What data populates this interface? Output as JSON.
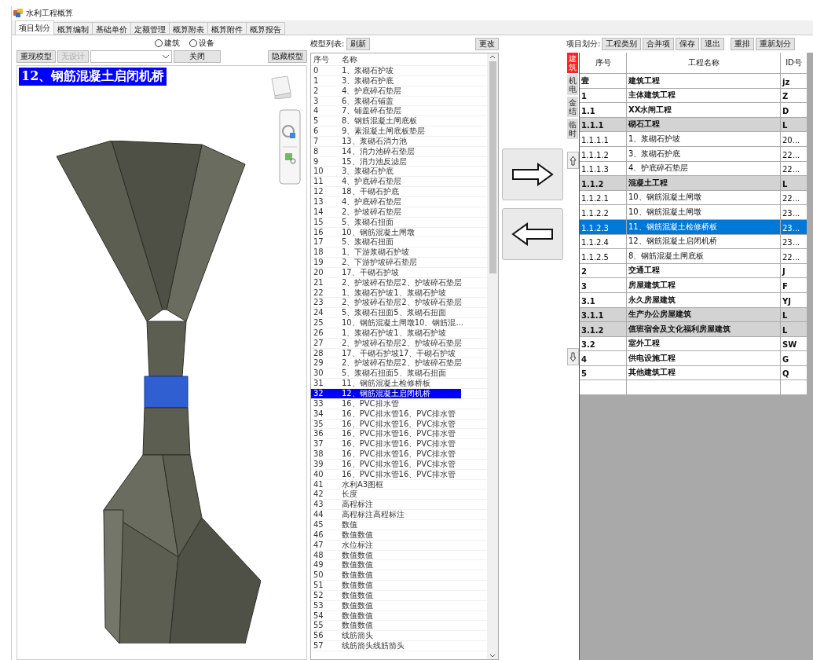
{
  "window": {
    "title": "水利工程概算"
  },
  "tabs": [
    {
      "label": "项目划分",
      "selected": true
    },
    {
      "label": "概算编制",
      "selected": false
    },
    {
      "label": "基础单价",
      "selected": false
    },
    {
      "label": "定额管理",
      "selected": false
    },
    {
      "label": "概算附表",
      "selected": false
    },
    {
      "label": "概算附件",
      "selected": false
    },
    {
      "label": "概算报告",
      "selected": false
    }
  ],
  "model_panel": {
    "radios": [
      {
        "label": "建筑",
        "checked": false
      },
      {
        "label": "设备",
        "checked": false
      }
    ],
    "buttons": [
      {
        "label": "重现模型",
        "disabled": false
      },
      {
        "label": "无设计",
        "disabled": true
      }
    ],
    "close_button": "关闭",
    "hide_button": "隐藏模型",
    "banner": "12、钢筋混凝土启闭机桥"
  },
  "model_list": {
    "label": "模型列表:",
    "refresh_button": "刷新",
    "change_button": "更改",
    "columns": [
      "序号",
      "名称"
    ],
    "rows": [
      {
        "index": "0",
        "name": "1、浆砌石护坡",
        "selected": false
      },
      {
        "index": "1",
        "name": "3、浆砌石护底",
        "selected": false
      },
      {
        "index": "2",
        "name": "4、护底碎石垫层",
        "selected": false
      },
      {
        "index": "3",
        "name": "6、浆砌石铺盖",
        "selected": false
      },
      {
        "index": "4",
        "name": "7、铺盖碎石垫层",
        "selected": false
      },
      {
        "index": "5",
        "name": "8、钢筋混凝土闸底板",
        "selected": false
      },
      {
        "index": "6",
        "name": "9、素混凝土闸底板垫层",
        "selected": false
      },
      {
        "index": "7",
        "name": "13、浆砌石消力池",
        "selected": false
      },
      {
        "index": "8",
        "name": "14、消力池碎石垫层",
        "selected": false
      },
      {
        "index": "9",
        "name": "15、消力池反滤层",
        "selected": false
      },
      {
        "index": "10",
        "name": "3、浆砌石护底",
        "selected": false
      },
      {
        "index": "11",
        "name": "4、护底碎石垫层",
        "selected": false
      },
      {
        "index": "12",
        "name": "18、干砌石护底",
        "selected": false
      },
      {
        "index": "13",
        "name": "4、护底碎石垫层",
        "selected": false
      },
      {
        "index": "14",
        "name": "2、护坡碎石垫层",
        "selected": false
      },
      {
        "index": "15",
        "name": "5、浆砌石扭面",
        "selected": false
      },
      {
        "index": "16",
        "name": "10、钢筋混凝土闸墩",
        "selected": false
      },
      {
        "index": "17",
        "name": "5、浆砌石扭面",
        "selected": false
      },
      {
        "index": "18",
        "name": "1、下游浆砌石护坡",
        "selected": false
      },
      {
        "index": "19",
        "name": "2、下游护坡碎石垫层",
        "selected": false
      },
      {
        "index": "20",
        "name": "17、干砌石护坡",
        "selected": false
      },
      {
        "index": "21",
        "name": "2、护坡碎石垫层2、护坡碎石垫层",
        "selected": false
      },
      {
        "index": "22",
        "name": "1、浆砌石护坡1、浆砌石护坡",
        "selected": false
      },
      {
        "index": "23",
        "name": "2、护坡碎石垫层2、护坡碎石垫层",
        "selected": false
      },
      {
        "index": "24",
        "name": "5、浆砌石扭面5、浆砌石扭面",
        "selected": false
      },
      {
        "index": "25",
        "name": "10、钢筋混凝土闸墩10、钢筋混...",
        "selected": false
      },
      {
        "index": "26",
        "name": "1、浆砌石护坡1、浆砌石护坡",
        "selected": false
      },
      {
        "index": "27",
        "name": "2、护坡碎石垫层2、护坡碎石垫层",
        "selected": false
      },
      {
        "index": "28",
        "name": "17、干砌石护坡17、干砌石护坡",
        "selected": false
      },
      {
        "index": "29",
        "name": "2、护坡碎石垫层2、护坡碎石垫层",
        "selected": false
      },
      {
        "index": "30",
        "name": "5、浆砌石扭面5、浆砌石扭面",
        "selected": false
      },
      {
        "index": "31",
        "name": "11、钢筋混凝土检修桥板",
        "selected": false
      },
      {
        "index": "32",
        "name": "12、钢筋混凝土启闭机桥",
        "selected": true
      },
      {
        "index": "33",
        "name": "16、PVC排水管",
        "selected": false
      },
      {
        "index": "34",
        "name": "16、PVC排水管16、PVC排水管",
        "selected": false
      },
      {
        "index": "35",
        "name": "16、PVC排水管16、PVC排水管",
        "selected": false
      },
      {
        "index": "36",
        "name": "16、PVC排水管16、PVC排水管",
        "selected": false
      },
      {
        "index": "37",
        "name": "16、PVC排水管16、PVC排水管",
        "selected": false
      },
      {
        "index": "38",
        "name": "16、PVC排水管16、PVC排水管",
        "selected": false
      },
      {
        "index": "39",
        "name": "16、PVC排水管16、PVC排水管",
        "selected": false
      },
      {
        "index": "40",
        "name": "16、PVC排水管16、PVC排水管",
        "selected": false
      },
      {
        "index": "41",
        "name": "水利A3图框",
        "selected": false
      },
      {
        "index": "42",
        "name": "长度",
        "selected": false
      },
      {
        "index": "43",
        "name": "高程标注",
        "selected": false
      },
      {
        "index": "44",
        "name": "高程标注高程标注",
        "selected": false
      },
      {
        "index": "45",
        "name": "数值",
        "selected": false
      },
      {
        "index": "46",
        "name": "数值数值",
        "selected": false
      },
      {
        "index": "47",
        "name": "水位标注",
        "selected": false
      },
      {
        "index": "48",
        "name": "数值数值",
        "selected": false
      },
      {
        "index": "49",
        "name": "数值数值",
        "selected": false
      },
      {
        "index": "50",
        "name": "数值数值",
        "selected": false
      },
      {
        "index": "51",
        "name": "数值数值",
        "selected": false
      },
      {
        "index": "52",
        "name": "数值数值",
        "selected": false
      },
      {
        "index": "53",
        "name": "数值数值",
        "selected": false
      },
      {
        "index": "54",
        "name": "数值数值",
        "selected": false
      },
      {
        "index": "55",
        "name": "数值数值",
        "selected": false
      },
      {
        "index": "56",
        "name": "线筋箭头",
        "selected": false
      },
      {
        "index": "57",
        "name": "线筋箭头线筋箭头",
        "selected": false
      }
    ]
  },
  "project_division": {
    "label": "项目划分:",
    "buttons": [
      "工程类别",
      "合并项",
      "保存",
      "退出",
      "重排",
      "重新划分"
    ],
    "side_tabs": [
      {
        "label": "建筑",
        "selected": true
      },
      {
        "label": "机电",
        "selected": false
      },
      {
        "label": "金结",
        "selected": false
      },
      {
        "label": "临时",
        "selected": false
      }
    ],
    "columns": [
      "序号",
      "工程名称",
      "ID号"
    ],
    "rows": [
      {
        "number": "壹",
        "name": "建筑工程",
        "id": "jz",
        "kind": "heading",
        "selected": false
      },
      {
        "number": "1",
        "name": "主体建筑工程",
        "id": "Z",
        "kind": "heading",
        "selected": false
      },
      {
        "number": "1.1",
        "name": "XX水闸工程",
        "id": "D",
        "kind": "heading",
        "selected": false
      },
      {
        "number": "1.1.1",
        "name": "砌石工程",
        "id": "L",
        "kind": "group",
        "selected": false
      },
      {
        "number": "1.1.1.1",
        "name": "1、浆砌石护坡",
        "id": "20...",
        "kind": "item",
        "selected": false
      },
      {
        "number": "1.1.1.2",
        "name": "3、浆砌石护底",
        "id": "22...",
        "kind": "item",
        "selected": false
      },
      {
        "number": "1.1.1.3",
        "name": "4、护底碎石垫层",
        "id": "22...",
        "kind": "item",
        "selected": false
      },
      {
        "number": "1.1.2",
        "name": "混凝土工程",
        "id": "L",
        "kind": "group",
        "selected": false
      },
      {
        "number": "1.1.2.1",
        "name": "10、钢筋混凝土闸墩",
        "id": "22...",
        "kind": "item",
        "selected": false
      },
      {
        "number": "1.1.2.2",
        "name": "10、钢筋混凝土闸墩",
        "id": "23...",
        "kind": "item",
        "selected": false
      },
      {
        "number": "1.1.2.3",
        "name": "11、钢筋混凝土检修桥板",
        "id": "23...",
        "kind": "item",
        "selected": true
      },
      {
        "number": "1.1.2.4",
        "name": "12、钢筋混凝土启闭机桥",
        "id": "23...",
        "kind": "item",
        "selected": false
      },
      {
        "number": "1.1.2.5",
        "name": "8、钢筋混凝土闸底板",
        "id": "22...",
        "kind": "item",
        "selected": false
      },
      {
        "number": "2",
        "name": "交通工程",
        "id": "J",
        "kind": "heading",
        "selected": false
      },
      {
        "number": "3",
        "name": "房屋建筑工程",
        "id": "F",
        "kind": "heading",
        "selected": false
      },
      {
        "number": "3.1",
        "name": "永久房屋建筑",
        "id": "YJ",
        "kind": "heading",
        "selected": false
      },
      {
        "number": "3.1.1",
        "name": "生产办公房屋建筑",
        "id": "L",
        "kind": "group",
        "selected": false
      },
      {
        "number": "3.1.2",
        "name": "值班宿舍及文化福利房屋建筑",
        "id": "L",
        "kind": "group",
        "selected": false
      },
      {
        "number": "3.2",
        "name": "室外工程",
        "id": "SW",
        "kind": "heading",
        "selected": false
      },
      {
        "number": "4",
        "name": "供电设施工程",
        "id": "G",
        "kind": "heading",
        "selected": false
      },
      {
        "number": "5",
        "name": "其他建筑工程",
        "id": "Q",
        "kind": "heading",
        "selected": false
      }
    ]
  }
}
